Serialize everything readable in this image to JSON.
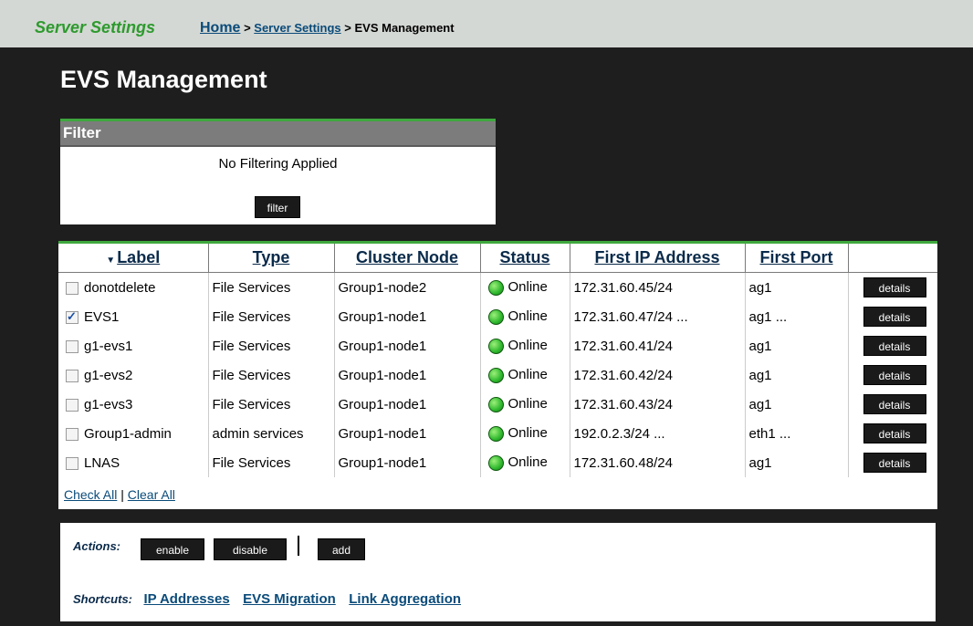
{
  "header": {
    "app_title": "Server Settings",
    "breadcrumb": {
      "home": "Home",
      "sep1": " > ",
      "server_settings": "Server Settings",
      "sep2": " > ",
      "current": "EVS Management"
    }
  },
  "page_title": "EVS Management",
  "filter": {
    "title": "Filter",
    "status": "No Filtering Applied",
    "button": "filter"
  },
  "table": {
    "columns": [
      "Label",
      "Type",
      "Cluster Node",
      "Status",
      "First IP Address",
      "First Port",
      ""
    ],
    "rows": [
      {
        "checked": false,
        "label": "donotdelete",
        "type": "File Services",
        "node": "Group1-node2",
        "status": "Online",
        "ip": "172.31.60.45/24",
        "port": "ag1",
        "action": "details"
      },
      {
        "checked": true,
        "label": "EVS1",
        "type": "File Services",
        "node": "Group1-node1",
        "status": "Online",
        "ip": "172.31.60.47/24 ...",
        "port": "ag1 ...",
        "action": "details"
      },
      {
        "checked": false,
        "label": "g1-evs1",
        "type": "File Services",
        "node": "Group1-node1",
        "status": "Online",
        "ip": "172.31.60.41/24",
        "port": "ag1",
        "action": "details"
      },
      {
        "checked": false,
        "label": "g1-evs2",
        "type": "File Services",
        "node": "Group1-node1",
        "status": "Online",
        "ip": "172.31.60.42/24",
        "port": "ag1",
        "action": "details"
      },
      {
        "checked": false,
        "label": "g1-evs3",
        "type": "File Services",
        "node": "Group1-node1",
        "status": "Online",
        "ip": "172.31.60.43/24",
        "port": "ag1",
        "action": "details"
      },
      {
        "checked": false,
        "label": "Group1-admin",
        "type": "admin services",
        "node": "Group1-node1",
        "status": "Online",
        "ip": "192.0.2.3/24 ...",
        "port": "eth1 ...",
        "action": "details"
      },
      {
        "checked": false,
        "label": "LNAS",
        "type": "File Services",
        "node": "Group1-node1",
        "status": "Online",
        "ip": "172.31.60.48/24",
        "port": "ag1",
        "action": "details"
      }
    ],
    "check_all": "Check All",
    "divider": " | ",
    "clear_all": "Clear All"
  },
  "actions": {
    "label": "Actions:",
    "enable": "enable",
    "disable": "disable",
    "add": "add"
  },
  "shortcuts": {
    "label": "Shortcuts:",
    "links": [
      "IP Addresses",
      "EVS Migration",
      "Link Aggregation"
    ]
  },
  "colors": {
    "accent_green": "#3ea83e",
    "link_blue": "#0a4b7a",
    "status_online": "#2eb82e"
  },
  "icons": {
    "sort": "sort-desc-icon",
    "status": "status-online-icon"
  }
}
